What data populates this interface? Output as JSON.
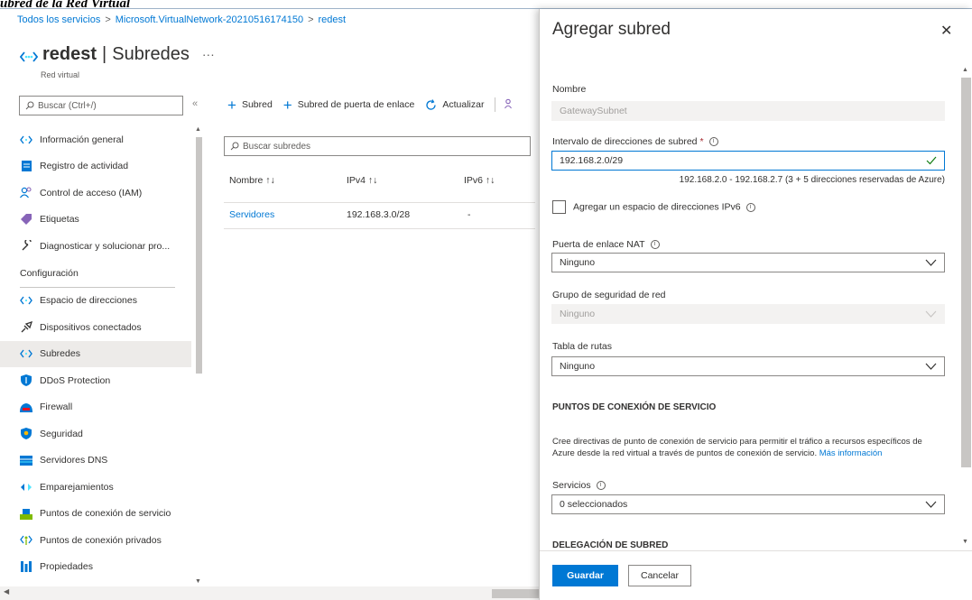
{
  "caption": "ubred de la Red Virtual",
  "breadcrumb": [
    "Todos los servicios",
    "Microsoft.VirtualNetwork-20210516174150",
    "redest"
  ],
  "blade": {
    "name": "redest",
    "section": "Subredes",
    "subtitle": "Red virtual",
    "more": "···"
  },
  "search": {
    "placeholder": "Buscar (Ctrl+/)",
    "collapse": "«"
  },
  "nav": {
    "items_top": [
      {
        "label": "Información general",
        "icon": "overview-icon"
      },
      {
        "label": "Registro de actividad",
        "icon": "activity-log-icon"
      },
      {
        "label": "Control de acceso (IAM)",
        "icon": "iam-icon"
      },
      {
        "label": "Etiquetas",
        "icon": "tag-icon"
      },
      {
        "label": "Diagnosticar y solucionar pro...",
        "icon": "wrench-icon"
      }
    ],
    "section": "Configuración",
    "items_config": [
      {
        "label": "Espacio de direcciones",
        "icon": "address-space-icon"
      },
      {
        "label": "Dispositivos conectados",
        "icon": "plug-icon"
      },
      {
        "label": "Subredes",
        "icon": "subnet-icon"
      },
      {
        "label": "DDoS Protection",
        "icon": "shield-icon"
      },
      {
        "label": "Firewall",
        "icon": "firewall-icon"
      },
      {
        "label": "Seguridad",
        "icon": "security-shield-icon"
      },
      {
        "label": "Servidores DNS",
        "icon": "dns-icon"
      },
      {
        "label": "Emparejamientos",
        "icon": "peering-icon"
      },
      {
        "label": "Puntos de conexión de servicio",
        "icon": "service-endpoint-icon"
      },
      {
        "label": "Puntos de conexión privados",
        "icon": "private-endpoint-icon"
      },
      {
        "label": "Propiedades",
        "icon": "properties-icon"
      }
    ]
  },
  "toolbar": {
    "add_subnet": "Subred",
    "add_gateway_subnet": "Subred de puerta de enlace",
    "refresh": "Actualizar"
  },
  "subnet_search": {
    "placeholder": "Buscar subredes"
  },
  "table": {
    "headers": [
      "Nombre ↑↓",
      "IPv4 ↑↓",
      "IPv6 ↑↓"
    ],
    "rows": [
      {
        "name": "Servidores",
        "ipv4": "192.168.3.0/28",
        "ipv6": "-"
      }
    ]
  },
  "panel": {
    "title": "Agregar subred",
    "close": "✕",
    "name_label": "Nombre",
    "name_value": "GatewaySubnet",
    "range_label": "Intervalo de direcciones de subred",
    "required": "*",
    "range_value": "192.168.2.0/29",
    "range_hint": "192.168.2.0 - 192.168.2.7 (3 + 5 direcciones reservadas de Azure)",
    "ipv6_checkbox": "Agregar un espacio de direcciones IPv6",
    "nat_label": "Puerta de enlace NAT",
    "nat_value": "Ninguno",
    "nsg_label": "Grupo de seguridad de red",
    "nsg_value": "Ninguno",
    "route_label": "Tabla de rutas",
    "route_value": "Ninguno",
    "endpoints_heading": "PUNTOS DE CONEXIÓN DE SERVICIO",
    "endpoints_desc_1": "Cree directivas de punto de conexión de servicio para permitir el tráfico a recursos específicos de",
    "endpoints_desc_2": "Azure desde la red virtual a través de puntos de conexión de servicio.",
    "more_info": "Más información",
    "services_label": "Servicios",
    "services_value": "0 seleccionados",
    "delegation_heading": "DELEGACIÓN DE SUBRED",
    "save": "Guardar",
    "cancel": "Cancelar"
  },
  "colors": {
    "accent": "#0078d4",
    "valid": "#107c10",
    "required": "#a4262c"
  }
}
